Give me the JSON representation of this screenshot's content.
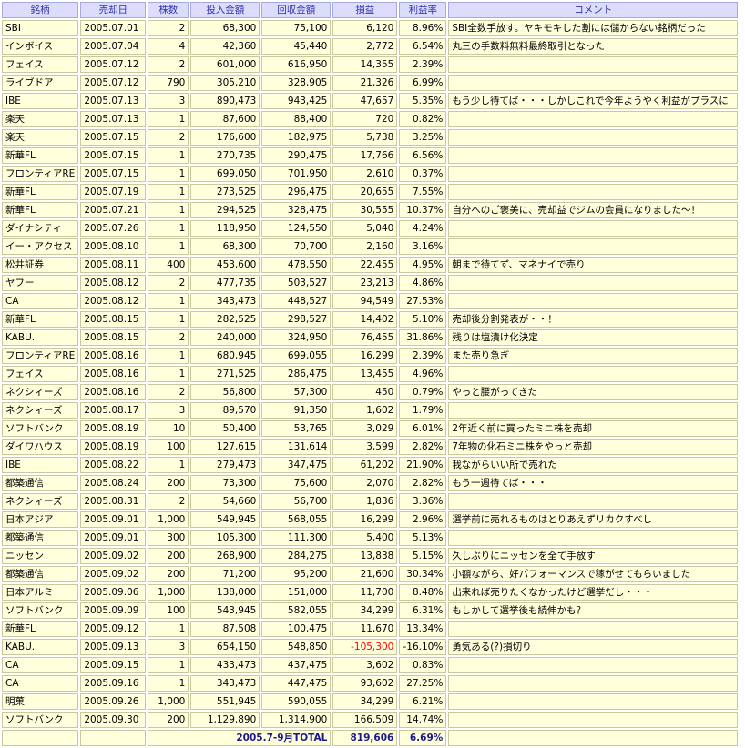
{
  "headers": [
    "銘柄",
    "売却日",
    "株数",
    "投入金額",
    "回収金額",
    "損益",
    "利益率",
    "コメント"
  ],
  "rows": [
    [
      "SBI",
      "2005.07.01",
      "2",
      "68,300",
      "75,100",
      "6,120",
      "8.96%",
      "SBI全数手放す。ヤキモキした割には儲からない銘柄だった"
    ],
    [
      "インボイス",
      "2005.07.04",
      "4",
      "42,360",
      "45,440",
      "2,772",
      "6.54%",
      "丸三の手数料無料最終取引となった"
    ],
    [
      "フェイス",
      "2005.07.12",
      "2",
      "601,000",
      "616,950",
      "14,355",
      "2.39%",
      ""
    ],
    [
      "ライブドア",
      "2005.07.12",
      "790",
      "305,210",
      "328,905",
      "21,326",
      "6.99%",
      ""
    ],
    [
      "IBE",
      "2005.07.13",
      "3",
      "890,473",
      "943,425",
      "47,657",
      "5.35%",
      "もう少し待てば・・・しかしこれで今年ようやく利益がプラスに"
    ],
    [
      "楽天",
      "2005.07.13",
      "1",
      "87,600",
      "88,400",
      "720",
      "0.82%",
      ""
    ],
    [
      "楽天",
      "2005.07.15",
      "2",
      "176,600",
      "182,975",
      "5,738",
      "3.25%",
      ""
    ],
    [
      "新華FL",
      "2005.07.15",
      "1",
      "270,735",
      "290,475",
      "17,766",
      "6.56%",
      ""
    ],
    [
      "フロンティアRE",
      "2005.07.15",
      "1",
      "699,050",
      "701,950",
      "2,610",
      "0.37%",
      ""
    ],
    [
      "新華FL",
      "2005.07.19",
      "1",
      "273,525",
      "296,475",
      "20,655",
      "7.55%",
      ""
    ],
    [
      "新華FL",
      "2005.07.21",
      "1",
      "294,525",
      "328,475",
      "30,555",
      "10.37%",
      "自分へのご褒美に、売却益でジムの会員になりました～！"
    ],
    [
      "ダイナシティ",
      "2005.07.26",
      "1",
      "118,950",
      "124,550",
      "5,040",
      "4.24%",
      ""
    ],
    [
      "イー・アクセス",
      "2005.08.10",
      "1",
      "68,300",
      "70,700",
      "2,160",
      "3.16%",
      ""
    ],
    [
      "松井証券",
      "2005.08.11",
      "400",
      "453,600",
      "478,550",
      "22,455",
      "4.95%",
      "朝まで待てず、マネナイで売り"
    ],
    [
      "ヤフー",
      "2005.08.12",
      "2",
      "477,735",
      "503,527",
      "23,213",
      "4.86%",
      ""
    ],
    [
      "CA",
      "2005.08.12",
      "1",
      "343,473",
      "448,527",
      "94,549",
      "27.53%",
      ""
    ],
    [
      "新華FL",
      "2005.08.15",
      "1",
      "282,525",
      "298,527",
      "14,402",
      "5.10%",
      "売却後分割発表が・・！"
    ],
    [
      "KABU.",
      "2005.08.15",
      "2",
      "240,000",
      "324,950",
      "76,455",
      "31.86%",
      "残りは塩漬け化決定"
    ],
    [
      "フロンティアRE",
      "2005.08.16",
      "1",
      "680,945",
      "699,055",
      "16,299",
      "2.39%",
      "また売り急ぎ"
    ],
    [
      "フェイス",
      "2005.08.16",
      "1",
      "271,525",
      "286,475",
      "13,455",
      "4.96%",
      ""
    ],
    [
      "ネクシィーズ",
      "2005.08.16",
      "2",
      "56,800",
      "57,300",
      "450",
      "0.79%",
      "やっと腰がってきた"
    ],
    [
      "ネクシィーズ",
      "2005.08.17",
      "3",
      "89,570",
      "91,350",
      "1,602",
      "1.79%",
      ""
    ],
    [
      "ソフトバンク",
      "2005.08.19",
      "10",
      "50,400",
      "53,765",
      "3,029",
      "6.01%",
      "2年近く前に買ったミニ株を売却"
    ],
    [
      "ダイワハウス",
      "2005.08.19",
      "100",
      "127,615",
      "131,614",
      "3,599",
      "2.82%",
      "7年物の化石ミニ株をやっと売却"
    ],
    [
      "IBE",
      "2005.08.22",
      "1",
      "279,473",
      "347,475",
      "61,202",
      "21.90%",
      "我ながらいい所で売れた"
    ],
    [
      "都築通信",
      "2005.08.24",
      "200",
      "73,300",
      "75,600",
      "2,070",
      "2.82%",
      "もう一週待てば・・・"
    ],
    [
      "ネクシィーズ",
      "2005.08.31",
      "2",
      "54,660",
      "56,700",
      "1,836",
      "3.36%",
      ""
    ],
    [
      "日本アジア",
      "2005.09.01",
      "1,000",
      "549,945",
      "568,055",
      "16,299",
      "2.96%",
      "選挙前に売れるものはとりあえずリカクすべし"
    ],
    [
      "都築通信",
      "2005.09.01",
      "300",
      "105,300",
      "111,300",
      "5,400",
      "5.13%",
      ""
    ],
    [
      "ニッセン",
      "2005.09.02",
      "200",
      "268,900",
      "284,275",
      "13,838",
      "5.15%",
      "久しぶりにニッセンを全て手放す"
    ],
    [
      "都築通信",
      "2005.09.02",
      "200",
      "71,200",
      "95,200",
      "21,600",
      "30.34%",
      "小額ながら、好パフォーマンスで稼がせてもらいました"
    ],
    [
      "日本アルミ",
      "2005.09.06",
      "1,000",
      "138,000",
      "151,000",
      "11,700",
      "8.48%",
      "出来れば売りたくなかったけど選挙だし・・・"
    ],
    [
      "ソフトバンク",
      "2005.09.09",
      "100",
      "543,945",
      "582,055",
      "34,299",
      "6.31%",
      "もしかして選挙後も続伸かも？"
    ],
    [
      "新華FL",
      "2005.09.12",
      "1",
      "87,508",
      "100,475",
      "11,670",
      "13.34%",
      ""
    ],
    [
      "KABU.",
      "2005.09.13",
      "3",
      "654,150",
      "548,850",
      "-105,300",
      "-16.10%",
      "勇気ある(?)損切り"
    ],
    [
      "CA",
      "2005.09.15",
      "1",
      "433,473",
      "437,475",
      "3,602",
      "0.83%",
      ""
    ],
    [
      "CA",
      "2005.09.16",
      "1",
      "343,473",
      "447,475",
      "93,602",
      "27.25%",
      ""
    ],
    [
      "明菓",
      "2005.09.26",
      "1,000",
      "551,945",
      "590,055",
      "34,299",
      "6.21%",
      ""
    ],
    [
      "ソフトバンク",
      "2005.09.30",
      "200",
      "1,129,890",
      "1,314,900",
      "166,509",
      "14.74%",
      ""
    ]
  ],
  "total": {
    "label": "2005.7-9月TOTAL",
    "profit": "819,606",
    "rate": "6.69%"
  },
  "colors": {
    "header_bg": "#dcdcfc",
    "header_text": "#3333aa",
    "cell_bg": "#ffffdc",
    "negative": "#ff0000",
    "total_text": "#1a1a8a"
  }
}
